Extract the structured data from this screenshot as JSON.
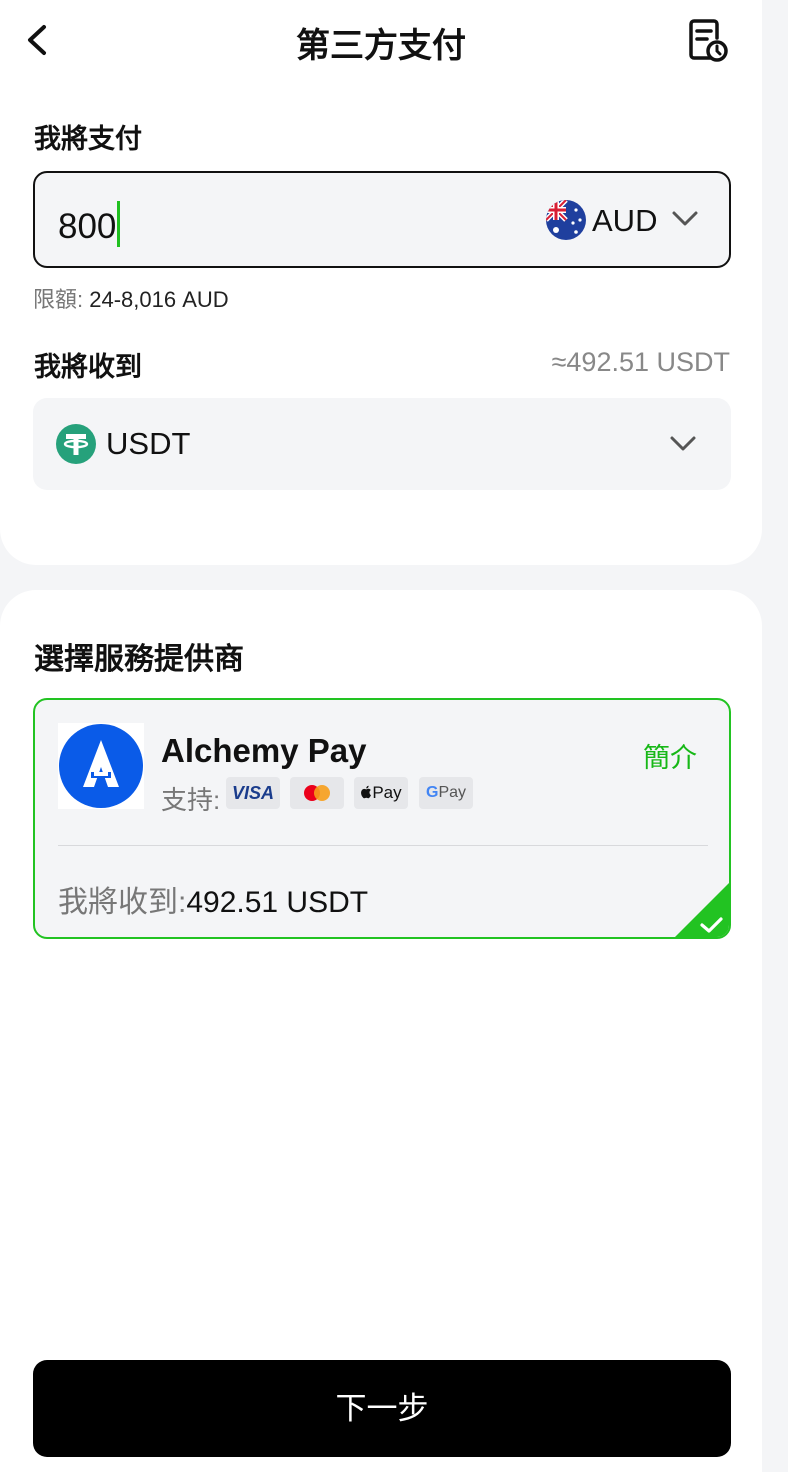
{
  "header": {
    "title": "第三方支付",
    "back_icon": "chevron-left-icon",
    "history_icon": "order-history-icon"
  },
  "pay": {
    "label": "我將支付",
    "amount": "800",
    "currency": "AUD",
    "currency_flag": "australia-flag-icon",
    "limit_label": "限額:",
    "limit_value": "24-8,016 AUD"
  },
  "receive": {
    "label": "我將收到",
    "approx": "≈492.51 USDT",
    "currency": "USDT",
    "currency_icon": "tether-icon"
  },
  "providers": {
    "section_title": "選擇服務提供商",
    "items": [
      {
        "name": "Alchemy Pay",
        "intro_label": "簡介",
        "support_label": "支持:",
        "methods": [
          "VISA",
          "Mastercard",
          "Pay",
          "Pay"
        ],
        "receive_label": "我將收到:",
        "receive_value": "492.51 USDT",
        "selected": true
      }
    ]
  },
  "footer": {
    "next_label": "下一步"
  },
  "colors": {
    "accent_green": "#22c322",
    "button_bg": "#000000",
    "surface": "#f4f5f7"
  }
}
